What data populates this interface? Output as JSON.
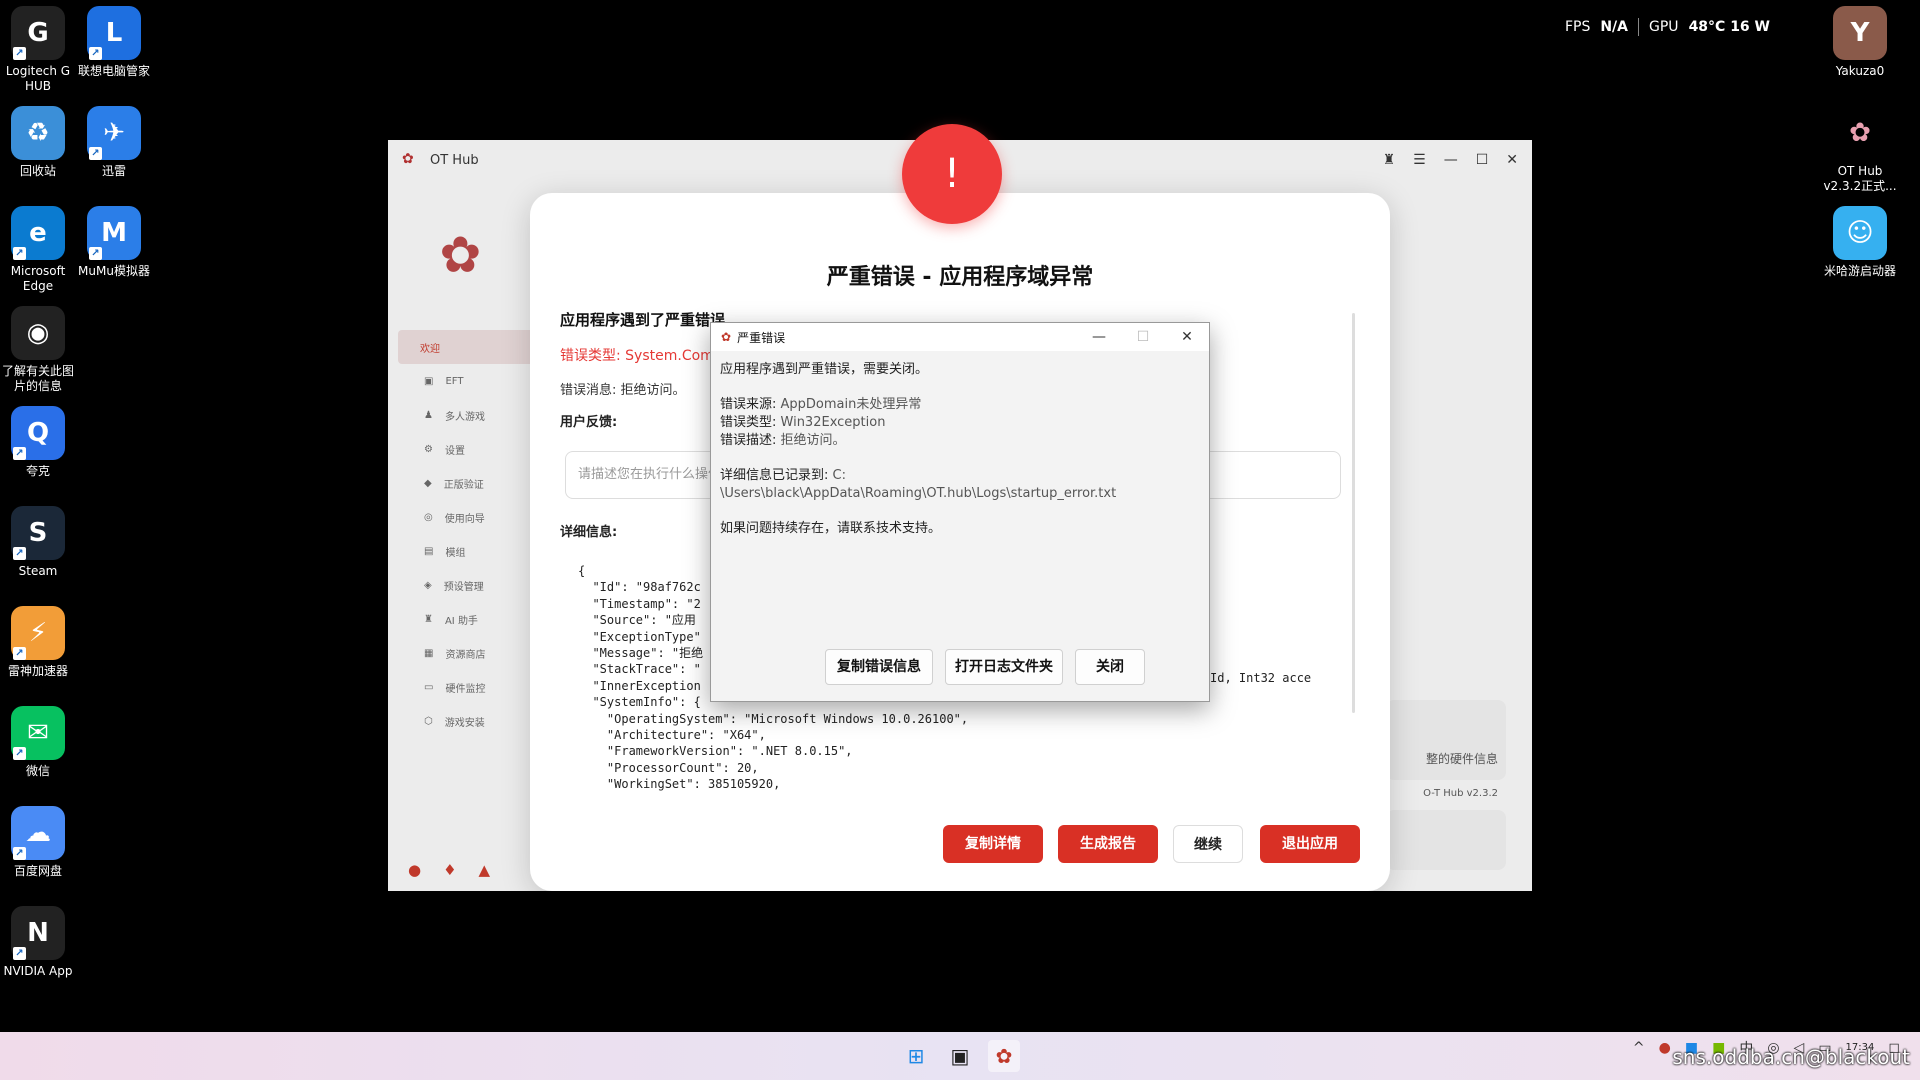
{
  "desktop": {
    "icons_left": [
      {
        "label": "Logitech G HUB",
        "glyph": "G"
      },
      {
        "label": "联想电脑管家",
        "glyph": "L"
      },
      {
        "label": "回收站",
        "glyph": "♻"
      },
      {
        "label": "迅雷",
        "glyph": "✈"
      },
      {
        "label": "Microsoft Edge",
        "glyph": "e"
      },
      {
        "label": "MuMu模拟器",
        "glyph": "M"
      },
      {
        "label": "了解有关此图片的信息",
        "glyph": "◉"
      },
      {
        "label": "夸克",
        "glyph": "Q"
      },
      {
        "label": "Steam",
        "glyph": "S"
      },
      {
        "label": "雷神加速器",
        "glyph": "⚡"
      },
      {
        "label": "微信",
        "glyph": "✉"
      },
      {
        "label": "百度网盘",
        "glyph": "☁"
      },
      {
        "label": "NVIDIA App",
        "glyph": "N"
      }
    ],
    "icons_right": [
      {
        "label": "Yakuza0",
        "glyph": "Y"
      },
      {
        "label": "OT Hub v2.3.2正式...",
        "glyph": "✿"
      },
      {
        "label": "米哈游启动器",
        "glyph": "☺"
      }
    ],
    "fps_label": "FPS",
    "fps_value": "N/A",
    "gpu_label": "GPU",
    "gpu_value": "48°C 16 W"
  },
  "app": {
    "title": "OT Hub",
    "sidebar": [
      {
        "label": "欢迎",
        "icon": "home-icon",
        "active": true
      },
      {
        "label": "EFT",
        "icon": "eft-icon"
      },
      {
        "label": "多人游戏",
        "icon": "users-icon"
      },
      {
        "label": "设置",
        "icon": "gear-icon"
      },
      {
        "label": "正版验证",
        "icon": "shield-icon"
      },
      {
        "label": "使用向导",
        "icon": "guide-icon"
      },
      {
        "label": "模组",
        "icon": "mod-icon"
      },
      {
        "label": "预设管理",
        "icon": "preset-icon"
      },
      {
        "label": "AI 助手",
        "icon": "robot-icon"
      },
      {
        "label": "资源商店",
        "icon": "store-icon"
      },
      {
        "label": "硬件监控",
        "icon": "monitor-icon"
      },
      {
        "label": "游戏安装",
        "icon": "install-icon"
      }
    ],
    "right_text": "整的硬件信息",
    "version": "O-T Hub  v2.3.2"
  },
  "error_panel": {
    "title": "严重错误 - 应用程序域异常",
    "heading": "应用程序遇到了严重错误",
    "error_type": "错误类型: System.Comp",
    "error_message": "错误消息: 拒绝访问。",
    "feedback_label": "用户反馈:",
    "feedback_placeholder": "请描述您在执行什么操作时遇到了此错误",
    "detail_label": "详细信息:",
    "code_lines": [
      "{",
      "  \"Id\": \"98af762c",
      "  \"Timestamp\": \"2",
      "  \"Source\": \"应用",
      "  \"ExceptionType\"",
      "  \"Message\": \"拒绝",
      "  \"StackTrace\": \"",
      "  \"InnerException",
      "  \"SystemInfo\": {",
      "    \"OperatingSystem\": \"Microsoft Windows 10.0.26100\",",
      "    \"Architecture\": \"X64\",",
      "    \"FrameworkVersion\": \".NET 8.0.15\",",
      "    \"ProcessorCount\": 20,",
      "    \"WorkingSet\": 385105920,"
    ],
    "code_right": "Id, Int32 acce",
    "buttons": {
      "copy": "复制详情",
      "report": "生成报告",
      "continue": "继续",
      "exit": "退出应用"
    }
  },
  "dialog": {
    "title": "严重错误",
    "line1": "应用程序遇到严重错误，需要关闭。",
    "source_label": "错误来源: ",
    "source_value": "AppDomain未处理异常",
    "type_label": "错误类型: ",
    "type_value": "Win32Exception",
    "desc_label": "错误描述: ",
    "desc_value": "拒绝访问。",
    "log_label": "详细信息已记录到: ",
    "log_path_1": "C:",
    "log_path_2": "\\Users\\black\\AppData\\Roaming\\OT.hub\\Logs\\startup_error.txt",
    "support": "如果问题持续存在，请联系技术支持。",
    "buttons": {
      "copy": "复制错误信息",
      "open_log": "打开日志文件夹",
      "close": "关闭"
    }
  },
  "taskbar": {
    "time": "17:34",
    "watermark": "sns.oddba.cn@blackout"
  },
  "colors": {
    "accent_red": "#d93025",
    "error_circle": "#ef3b3b"
  }
}
